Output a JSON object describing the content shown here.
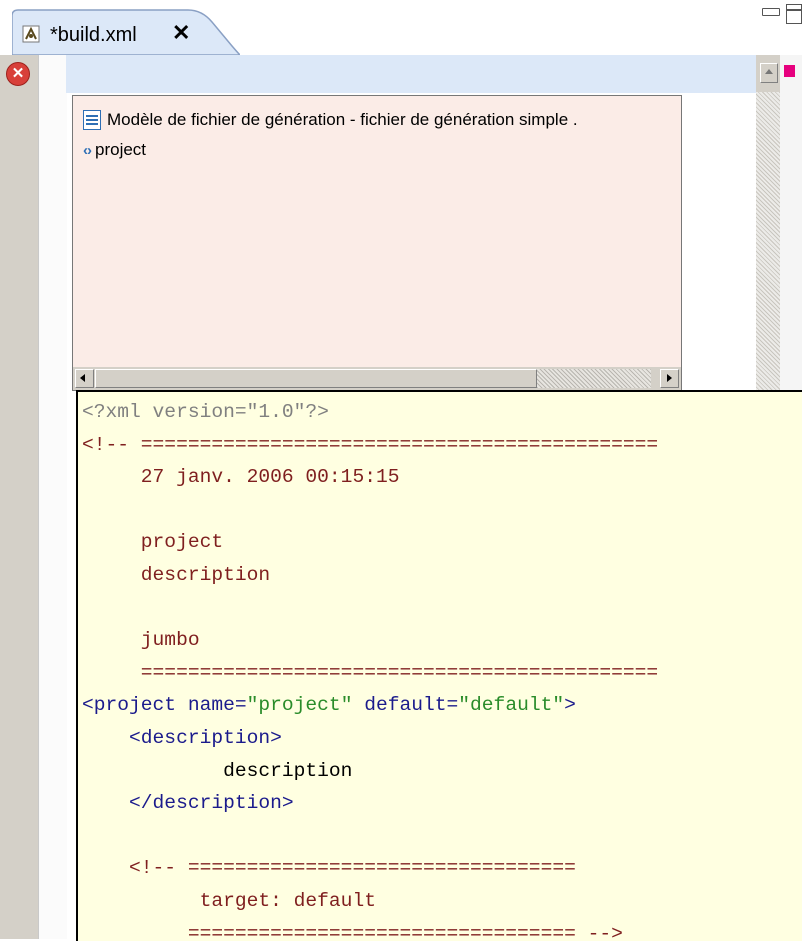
{
  "tab": {
    "title": "*build.xml",
    "close": "✕"
  },
  "popup": {
    "items": [
      {
        "icon": "template-doc-icon",
        "label": "Modèle de fichier de génération - fichier de génération simple ."
      },
      {
        "icon": "xml-tag-icon",
        "label": "project"
      }
    ]
  },
  "code_lines": [
    "<?xml version=\"1.0\"?>",
    "<!-- ============================================",
    "     27 janv. 2006 00:15:15",
    "",
    "     project",
    "     description",
    "",
    "     jumbo",
    "     ============================================",
    "<project name=\"project\" default=\"default\">",
    "    <description>",
    "            description",
    "    </description>",
    "",
    "    <!-- =================================",
    "          target: default",
    "         ================================= -->"
  ],
  "colors": {
    "tab_bg": "#dce8f8",
    "popup_bg": "#fbece7",
    "codebox_bg": "#ffffe1",
    "comment": "#7f1f1f",
    "tag": "#1b1b8c",
    "value": "#2a8c2a",
    "overview_marker": "#e6007e",
    "error": "#d8403a"
  }
}
